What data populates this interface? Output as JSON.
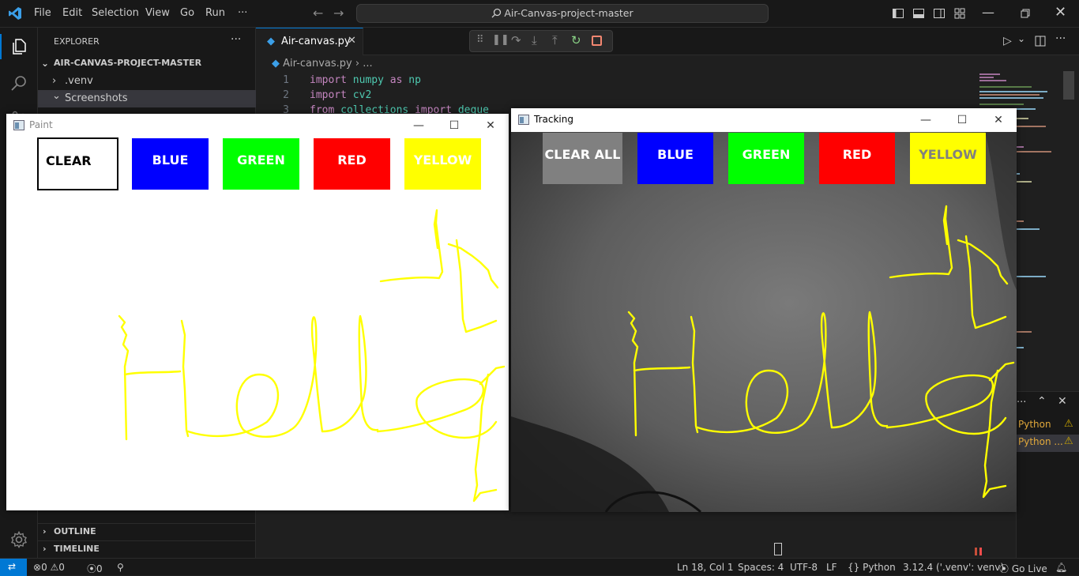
{
  "titlebar": {
    "menus": [
      "File",
      "Edit",
      "Selection",
      "View",
      "Go",
      "Run",
      "···"
    ],
    "search_text": "Air-Canvas-project-master"
  },
  "sidebar": {
    "header": "EXPLORER",
    "header_more": "···",
    "project": "AIR-CANVAS-PROJECT-MASTER",
    "items": [
      {
        "label": ".venv",
        "chevron": "›"
      },
      {
        "label": "Screenshots",
        "chevron": "⌄"
      }
    ],
    "outline": "OUTLINE",
    "timeline": "TIMELINE"
  },
  "editor": {
    "tab_label": "Air-canvas.py",
    "breadcrumb_file": "Air-canvas.py",
    "breadcrumb_rest": "› ...",
    "lines": [
      {
        "num": "1",
        "kw": "import",
        "a": "numpy",
        "kw2": "as",
        "b": "np"
      },
      {
        "num": "2",
        "kw": "import",
        "a": "cv2",
        "kw2": "",
        "b": ""
      },
      {
        "num": "3",
        "kw": "from",
        "a": "collections",
        "kw2": "import",
        "b": "deque"
      }
    ]
  },
  "panel": {
    "items": [
      {
        "label": "Python"
      },
      {
        "label": "Python ..."
      }
    ]
  },
  "statusbar": {
    "errors": "0",
    "warnings": "0",
    "ports": "0",
    "position": "Ln 18, Col 1",
    "spaces": "Spaces: 4",
    "encoding": "UTF-8",
    "eol": "LF",
    "language": "Python",
    "interpreter": "3.12.4 ('.venv': venv)",
    "golive": "Go Live"
  },
  "paint_window": {
    "title": "Paint",
    "buttons": [
      {
        "label": "CLEAR",
        "color": "#ffffff",
        "text_color": "#000000"
      },
      {
        "label": "BLUE",
        "color": "#0000ff",
        "text_color": "#ffffff"
      },
      {
        "label": "GREEN",
        "color": "#00ff00",
        "text_color": "#ffffff"
      },
      {
        "label": "RED",
        "color": "#ff0000",
        "text_color": "#ffffff"
      },
      {
        "label": "YELLOW",
        "color": "#ffff00",
        "text_color": "#ffffff"
      }
    ],
    "stroke_color": "#ffff00"
  },
  "tracking_window": {
    "title": "Tracking",
    "buttons": [
      {
        "label": "CLEAR ALL",
        "color": "#808080",
        "text_color": "#ffffff"
      },
      {
        "label": "BLUE",
        "color": "#0000ff",
        "text_color": "#ffffff"
      },
      {
        "label": "GREEN",
        "color": "#00ff00",
        "text_color": "#ffffff"
      },
      {
        "label": "RED",
        "color": "#ff0000",
        "text_color": "#ffffff"
      },
      {
        "label": "YELLOW",
        "color": "#ffff00",
        "text_color": "#808080"
      }
    ],
    "stroke_color": "#ffff00"
  }
}
